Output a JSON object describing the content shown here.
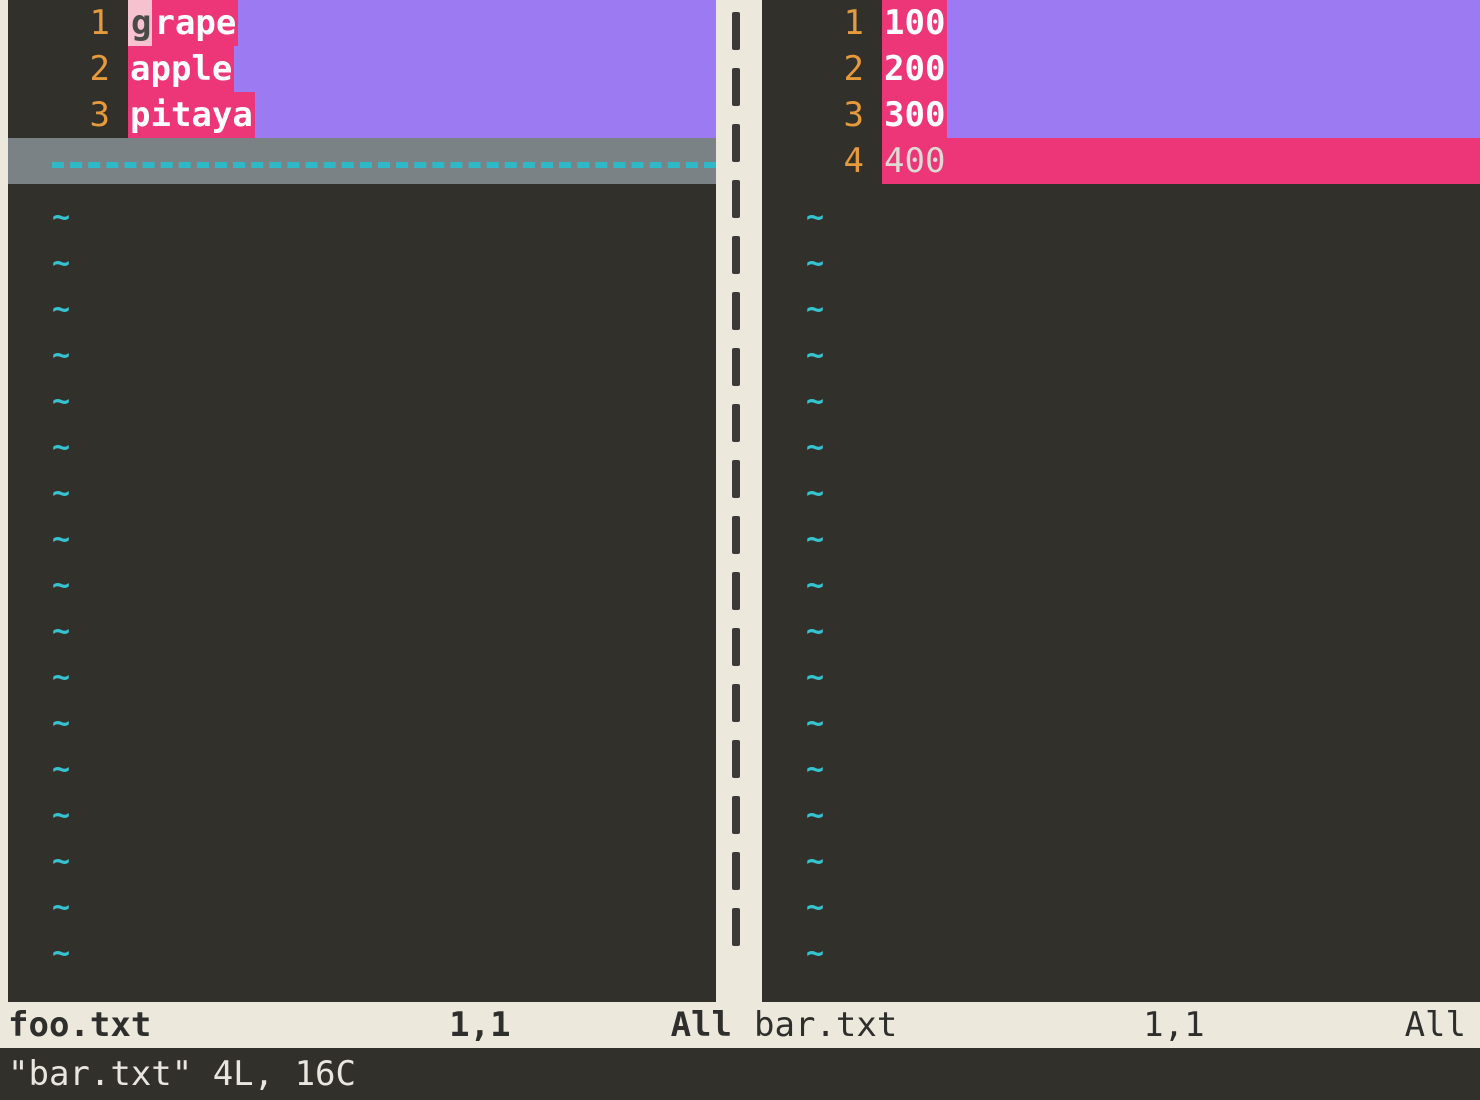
{
  "left_pane": {
    "filename": "foo.txt",
    "cursor_pos": "1,1",
    "scroll_pct": "All",
    "lines": [
      {
        "num": "1",
        "text_head": "g",
        "text_tail": "rape",
        "cursor": true
      },
      {
        "num": "2",
        "text_head": "",
        "text_tail": "apple",
        "cursor": false
      },
      {
        "num": "3",
        "text_head": "",
        "text_tail": "pitaya",
        "cursor": false
      }
    ],
    "tilde_count": 17,
    "tilde_glyph": "~"
  },
  "right_pane": {
    "filename": "bar.txt",
    "cursor_pos": "1,1",
    "scroll_pct": "All",
    "lines": [
      {
        "num": "1",
        "text": "100",
        "row_bg": "change",
        "text_bg": "pink"
      },
      {
        "num": "2",
        "text": "200",
        "row_bg": "change",
        "text_bg": "pink"
      },
      {
        "num": "3",
        "text": "300",
        "row_bg": "change",
        "text_bg": "pink"
      },
      {
        "num": "4",
        "text": "400",
        "row_bg": "add",
        "text_bg": "none"
      }
    ],
    "tilde_count": 17,
    "tilde_glyph": "~"
  },
  "vsplit_dash_count": 17,
  "cmdline": "\"bar.txt\" 4L, 16C"
}
